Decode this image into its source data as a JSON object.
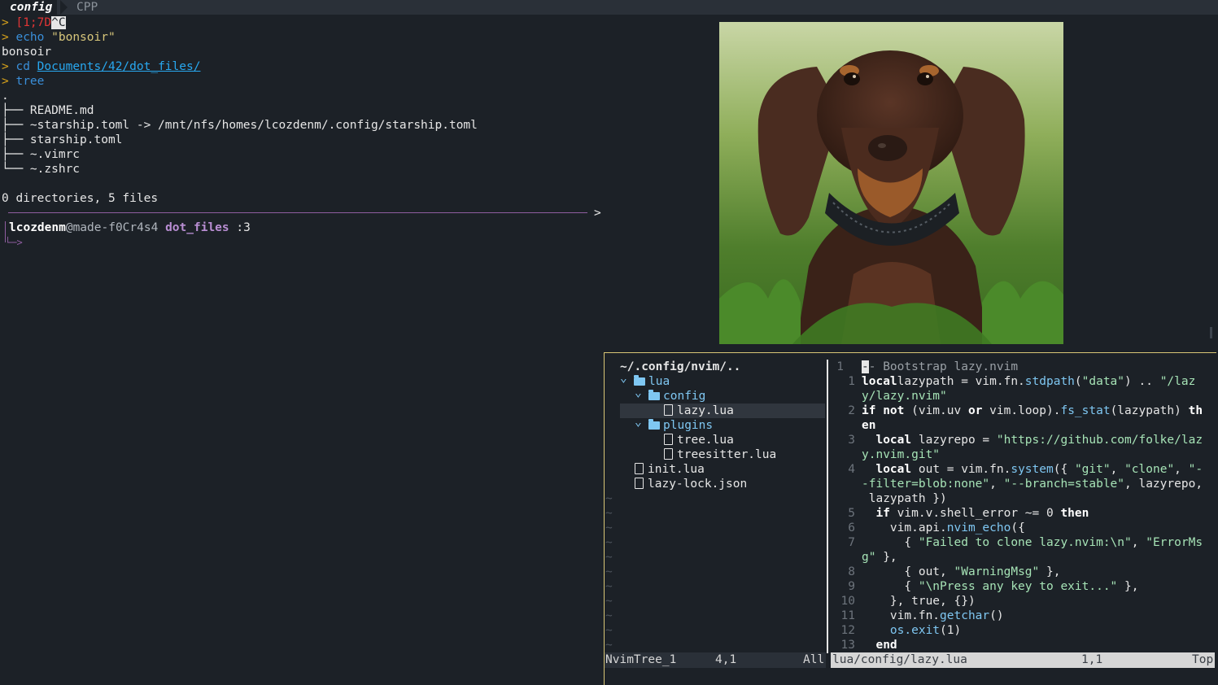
{
  "tabs": {
    "active": "config",
    "inactive": "CPP"
  },
  "terminal": {
    "lines": [
      {
        "prompt": ">",
        "cmd": "[1;7D",
        "tail": "^C"
      },
      {
        "prompt": ">",
        "cmd": "echo",
        "arg": "\"bonsoir\""
      },
      {
        "out": "bonsoir"
      },
      {
        "prompt": ">",
        "cmd": "cd",
        "arg": "Documents/42/dot_files/"
      },
      {
        "prompt": ">",
        "cmd": "tree"
      },
      {
        "out": "."
      },
      {
        "out": "├── README.md"
      },
      {
        "out": "├── ~starship.toml -> /mnt/nfs/homes/lcozdenm/.config/starship.toml"
      },
      {
        "out": "├── starship.toml"
      },
      {
        "out": "├── ~.vimrc"
      },
      {
        "out": "└── ~.zshrc"
      },
      {
        "out": ""
      },
      {
        "out": "0 directories, 5 files"
      }
    ],
    "separator_arrow": ">",
    "prompt_user": "lcozdenm",
    "prompt_at": "@",
    "prompt_host": "made-f0Cr4s4",
    "prompt_dir": "dot_files",
    "prompt_tail": ":3",
    "prompt_arrow": "└─>"
  },
  "image": {
    "description_icon": "dachshund-photo"
  },
  "nvim": {
    "tree": {
      "root": "~/.config/nvim/..",
      "items": [
        {
          "indent": 1,
          "type": "folder",
          "open": true,
          "name": "lua"
        },
        {
          "indent": 2,
          "type": "folder",
          "open": true,
          "name": "config"
        },
        {
          "indent": 3,
          "type": "file",
          "name": "lazy.lua",
          "selected": true
        },
        {
          "indent": 2,
          "type": "folder",
          "open": true,
          "name": "plugins"
        },
        {
          "indent": 3,
          "type": "file",
          "name": "tree.lua"
        },
        {
          "indent": 3,
          "type": "file",
          "name": "treesitter.lua"
        },
        {
          "indent": 1,
          "type": "file",
          "name": "init.lua"
        },
        {
          "indent": 1,
          "type": "file",
          "name": "lazy-lock.json"
        }
      ]
    },
    "code": [
      {
        "n": "1",
        "cur": true,
        "parts": [
          [
            "cm",
            "- Bootstrap lazy.nvim"
          ]
        ]
      },
      {
        "n": "1",
        "parts": [
          [
            "kw",
            "local"
          ],
          [
            "",
            "lazypath = vim.fn."
          ],
          [
            "fn",
            "stdpath"
          ],
          [
            "",
            "("
          ],
          [
            "s",
            "\"data\""
          ],
          [
            "",
            ") .. "
          ],
          [
            "s",
            "\"/laz"
          ]
        ]
      },
      {
        "n": "",
        "parts": [
          [
            "s",
            "y/lazy.nvim\""
          ]
        ]
      },
      {
        "n": "2",
        "parts": [
          [
            "kw",
            "if not"
          ],
          [
            "",
            " (vim.uv "
          ],
          [
            "kw",
            "or"
          ],
          [
            "",
            " vim.loop)."
          ],
          [
            "fn",
            "fs_stat"
          ],
          [
            "",
            "(lazypath) "
          ],
          [
            "kw",
            "th"
          ]
        ]
      },
      {
        "n": "",
        "parts": [
          [
            "kw",
            "en"
          ]
        ]
      },
      {
        "n": "3",
        "parts": [
          [
            "",
            "  "
          ],
          [
            "kw",
            "local"
          ],
          [
            "",
            " lazyrepo = "
          ],
          [
            "s",
            "\"https://github.com/folke/laz"
          ]
        ]
      },
      {
        "n": "",
        "parts": [
          [
            "s",
            "y.nvim.git\""
          ]
        ]
      },
      {
        "n": "4",
        "parts": [
          [
            "",
            "  "
          ],
          [
            "kw",
            "local"
          ],
          [
            "",
            " out = vim.fn."
          ],
          [
            "fn",
            "system"
          ],
          [
            "",
            "({ "
          ],
          [
            "s",
            "\"git\""
          ],
          [
            "",
            ", "
          ],
          [
            "s",
            "\"clone\""
          ],
          [
            "",
            ", "
          ],
          [
            "s",
            "\"-"
          ]
        ]
      },
      {
        "n": "",
        "parts": [
          [
            "s",
            "-filter=blob:none\""
          ],
          [
            "",
            ", "
          ],
          [
            "s",
            "\"--branch=stable\""
          ],
          [
            "",
            ", lazyrepo,"
          ]
        ]
      },
      {
        "n": "",
        "parts": [
          [
            "",
            " lazypath })"
          ]
        ]
      },
      {
        "n": "5",
        "parts": [
          [
            "",
            "  "
          ],
          [
            "kw",
            "if"
          ],
          [
            "",
            " vim.v.shell_error ~= 0 "
          ],
          [
            "kw",
            "then"
          ]
        ]
      },
      {
        "n": "6",
        "parts": [
          [
            "",
            "    vim.api."
          ],
          [
            "fn",
            "nvim_echo"
          ],
          [
            "",
            "({"
          ]
        ]
      },
      {
        "n": "7",
        "parts": [
          [
            "",
            "      { "
          ],
          [
            "s",
            "\"Failed to clone lazy.nvim:\\n\""
          ],
          [
            "",
            ", "
          ],
          [
            "s",
            "\"ErrorMs"
          ]
        ]
      },
      {
        "n": "",
        "parts": [
          [
            "s",
            "g\""
          ],
          [
            "",
            " },"
          ]
        ]
      },
      {
        "n": "8",
        "parts": [
          [
            "",
            "      { out, "
          ],
          [
            "s",
            "\"WarningMsg\""
          ],
          [
            "",
            " },"
          ]
        ]
      },
      {
        "n": "9",
        "parts": [
          [
            "",
            "      { "
          ],
          [
            "s",
            "\"\\nPress any key to exit...\""
          ],
          [
            "",
            " },"
          ]
        ]
      },
      {
        "n": "10",
        "parts": [
          [
            "",
            "    }, true, {})"
          ]
        ]
      },
      {
        "n": "11",
        "parts": [
          [
            "",
            "    vim.fn."
          ],
          [
            "fn",
            "getchar"
          ],
          [
            "",
            "()"
          ]
        ]
      },
      {
        "n": "12",
        "parts": [
          [
            "",
            "    "
          ],
          [
            "fn",
            "os.exit"
          ],
          [
            "",
            "(1)"
          ]
        ]
      },
      {
        "n": "13",
        "parts": [
          [
            "",
            "  "
          ],
          [
            "kw",
            "end"
          ]
        ]
      }
    ],
    "status_left": {
      "name": "NvimTree_1",
      "pos": "4,1",
      "scroll": "All"
    },
    "status_right": {
      "file": "lua/config/lazy.lua",
      "pos": "1,1",
      "scroll": "Top"
    }
  }
}
